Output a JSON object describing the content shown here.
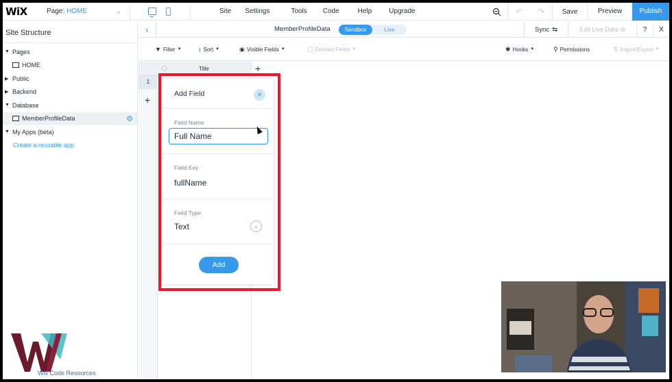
{
  "topbar": {
    "logo": "WiX",
    "page_label": "Page:",
    "page_value": "HOME",
    "menu": [
      "Site",
      "Settings",
      "Tools",
      "Code",
      "Help",
      "Upgrade"
    ],
    "save": "Save",
    "preview": "Preview",
    "publish": "Publish"
  },
  "sidebar": {
    "title": "Site Structure",
    "items": [
      {
        "label": "Pages"
      },
      {
        "label": "HOME"
      },
      {
        "label": "Public"
      },
      {
        "label": "Backend"
      },
      {
        "label": "Database"
      },
      {
        "label": "MemberProfileData"
      },
      {
        "label": "My Apps (beta)"
      },
      {
        "label": "Create a reusable app"
      }
    ],
    "watermark": "Wix Code Resources"
  },
  "collection": {
    "name": "MemberProfileData",
    "sandbox": "Sandbox",
    "live": "Live",
    "sync": "Sync",
    "edit_live": "Edit Live Data",
    "help": "?",
    "close": "X"
  },
  "toolbar": {
    "filter": "Filter",
    "sort": "Sort",
    "visible_fields": "Visible Fields",
    "deleted_fields": "Deleted Fields",
    "hooks": "Hooks",
    "permissions": "Permissions",
    "import_export": "Import/Export"
  },
  "grid": {
    "column_title": "Title",
    "row_number": "1"
  },
  "add_field": {
    "title": "Add Field",
    "field_name_label": "Field Name",
    "field_name_value": "Full Name",
    "field_key_label": "Field Key",
    "field_key_value": "fullName",
    "field_type_label": "Field Type",
    "field_type_value": "Text",
    "add_button": "Add"
  },
  "colors": {
    "accent": "#3899ec",
    "highlight_box": "#e8192c"
  }
}
